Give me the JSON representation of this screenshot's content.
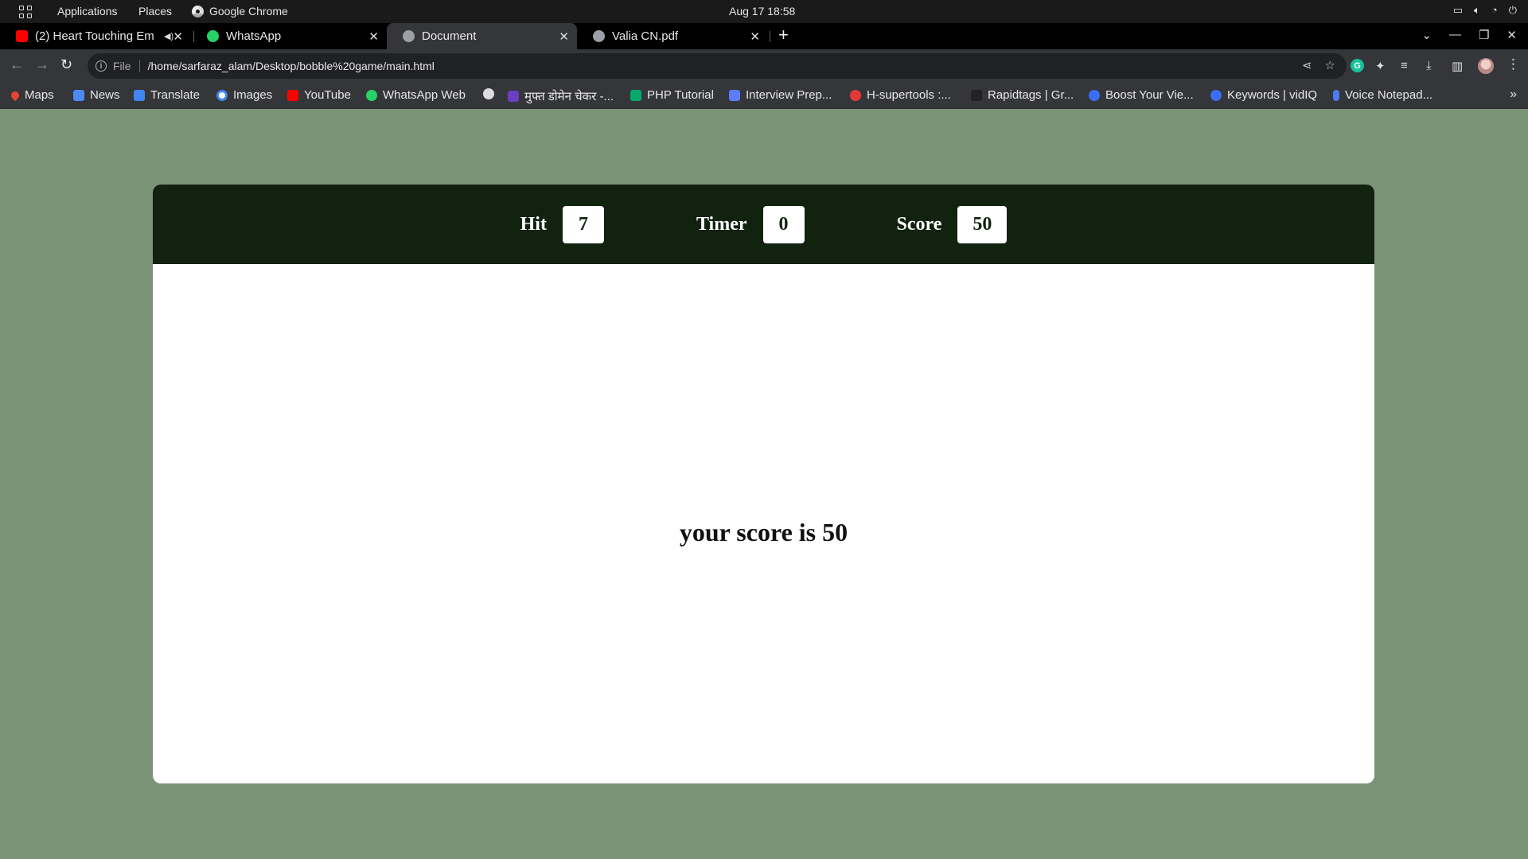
{
  "system_bar": {
    "applications": "Applications",
    "places": "Places",
    "active_app": "Google Chrome",
    "clock": "Aug 17  18:58"
  },
  "tabs": [
    {
      "title": "(2) Heart Touching Em",
      "favicon": "youtube-icon",
      "color": "#ff0000",
      "audio": true
    },
    {
      "title": "WhatsApp",
      "favicon": "whatsapp-icon",
      "color": "#25d366"
    },
    {
      "title": "Document",
      "favicon": "globe-icon",
      "color": "#9aa0a6",
      "active": true
    },
    {
      "title": "Valia CN.pdf",
      "favicon": "globe-icon",
      "color": "#9aa0a6"
    }
  ],
  "address_bar": {
    "scheme": "File",
    "url": "/home/sarfaraz_alam/Desktop/bobble%20game/main.html"
  },
  "bookmarks": [
    {
      "label": "Maps",
      "icon": "maps-icon"
    },
    {
      "label": "News",
      "icon": "news-icon"
    },
    {
      "label": "Translate",
      "icon": "translate-icon"
    },
    {
      "label": "Images",
      "icon": "google-icon"
    },
    {
      "label": "YouTube",
      "icon": "youtube-icon"
    },
    {
      "label": "WhatsApp Web",
      "icon": "whatsapp-icon"
    },
    {
      "label": "",
      "icon": "globe-icon"
    },
    {
      "label": "मुफ्त डोमेन चेकर -...",
      "icon": "domain-icon"
    },
    {
      "label": "PHP Tutorial",
      "icon": "w3-icon"
    },
    {
      "label": "Interview Prep...",
      "icon": "interview-icon"
    },
    {
      "label": "H-supertools :...",
      "icon": "hsupertools-icon"
    },
    {
      "label": "Rapidtags | Gr...",
      "icon": "rapidtags-icon"
    },
    {
      "label": "Boost Your Vie...",
      "icon": "vidiq-icon"
    },
    {
      "label": "Keywords | vidIQ",
      "icon": "vidiq-icon"
    },
    {
      "label": "Voice Notepad...",
      "icon": "microphone-icon"
    }
  ],
  "game": {
    "hit_label": "Hit",
    "hit_value": "7",
    "timer_label": "Timer",
    "timer_value": "0",
    "score_label": "Score",
    "score_value": "50",
    "final_message": "your score is 50"
  },
  "colors": {
    "page_background": "#7b9478",
    "game_header": "#11230f",
    "game_panel": "#ffffff"
  }
}
